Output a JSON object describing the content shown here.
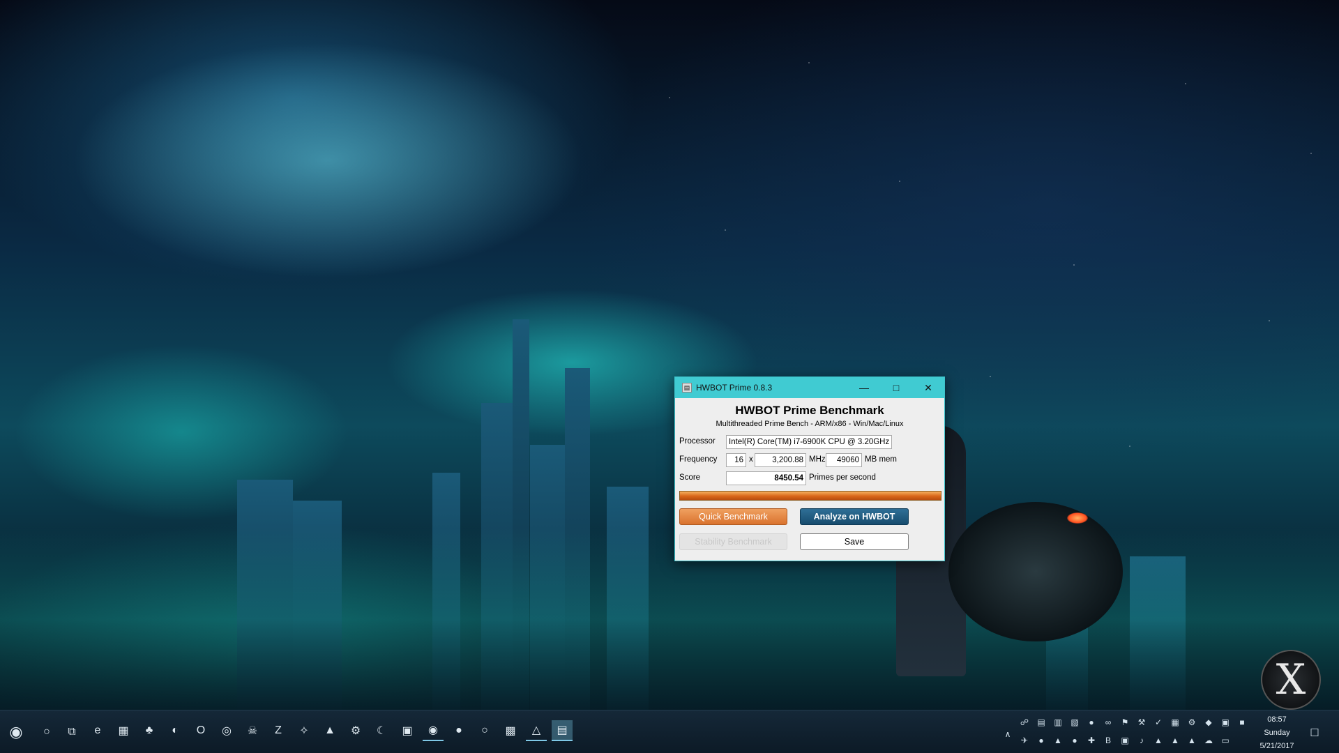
{
  "window": {
    "title": "HWBOT Prime 0.8.3",
    "heading": "HWBOT Prime Benchmark",
    "subheading": "Multithreaded Prime Bench - ARM/x86 - Win/Mac/Linux",
    "processor_label": "Processor",
    "processor_value": "Intel(R) Core(TM) i7-6900K CPU @ 3.20GHz",
    "frequency_label": "Frequency",
    "threads": "16",
    "times": "x",
    "frequency_value": "3,200.88",
    "mhz": "MHz",
    "memory_value": "49060",
    "mem_unit": "MB mem",
    "score_label": "Score",
    "score_value": "8450.54",
    "score_unit": "Primes per second",
    "progress_fraction": 1.0,
    "buttons": {
      "quick": "Quick Benchmark",
      "analyze": "Analyze on HWBOT",
      "stability": "Stability Benchmark",
      "save": "Save"
    },
    "controls": {
      "minimize": "—",
      "maximize": "□",
      "close": "✕"
    }
  },
  "taskbar": {
    "start_glyph": "◉",
    "search_glyph": "○",
    "taskview_glyph": "⧉",
    "pinned": [
      {
        "name": "edge-icon",
        "glyph": "e"
      },
      {
        "name": "store-icon",
        "glyph": "▦"
      },
      {
        "name": "clover-icon",
        "glyph": "♣"
      },
      {
        "name": "ghost-app-icon",
        "glyph": "◐"
      },
      {
        "name": "outlook-icon",
        "glyph": "O"
      },
      {
        "name": "chrome-icon",
        "glyph": "◎"
      },
      {
        "name": "alien-icon",
        "glyph": "☠"
      },
      {
        "name": "filezilla-icon",
        "glyph": "Z"
      },
      {
        "name": "feather-icon",
        "glyph": "✧"
      },
      {
        "name": "vlc-icon",
        "glyph": "▲"
      },
      {
        "name": "steam-icon",
        "glyph": "⚙"
      },
      {
        "name": "moon-icon",
        "glyph": "☾"
      },
      {
        "name": "display-icon",
        "glyph": "▣"
      },
      {
        "name": "spotify-icon",
        "glyph": "◉"
      },
      {
        "name": "record-icon",
        "glyph": "●"
      },
      {
        "name": "circle-app-icon",
        "glyph": "○"
      },
      {
        "name": "grid-app-icon",
        "glyph": "▩"
      },
      {
        "name": "hwbot-mountain-icon",
        "glyph": "△"
      },
      {
        "name": "hwbot-prime-icon",
        "glyph": "▤"
      }
    ],
    "tray_row1": [
      "☍",
      "▤",
      "▥",
      "▧",
      "●",
      "∞",
      "⚑",
      "⚒",
      "✓",
      "▦",
      "⚙",
      "◆",
      "▣",
      "■"
    ],
    "tray_row2": [
      "✈",
      "●",
      "▲",
      "●",
      "✚",
      "B",
      "▣",
      "♪",
      "▲",
      "▲",
      "▲",
      "☁",
      "▭"
    ],
    "tray_expand": "∧",
    "clock_time": "08:57",
    "clock_day": "Sunday",
    "clock_date": "5/21/2017",
    "notification_glyph": "☐"
  },
  "desktop": {
    "logo_glyph": "X",
    "accent_colors": {
      "titlebar": "#40cbd2",
      "quick_button": "#d9732e",
      "analyze_button": "#174c6e",
      "progress": "#d9661a"
    }
  }
}
